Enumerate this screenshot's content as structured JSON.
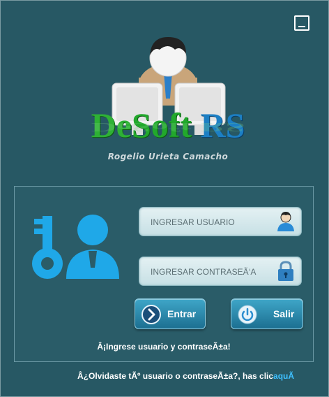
{
  "window": {
    "minimize_icon": "minimize-icon"
  },
  "brand": {
    "part1": "De",
    "part2": "Soft",
    "part3": " RS",
    "reflection": "DeSoft RS",
    "author": "Rogelio Urieta Camacho",
    "colors": {
      "green": "#22a82c",
      "blue": "#1c7fc4"
    }
  },
  "login": {
    "user_placeholder": "INGRESAR USUARIO",
    "password_placeholder": "INGRESAR CONTRASEÃ‘A",
    "enter_label": "Entrar",
    "exit_label": "Salir",
    "message": "Â¡Ingrese usuario y contraseÃ±a!"
  },
  "footer": {
    "forgot_text": "Â¿Olvidaste tÃº usuario o contraseÃ±a?, has clic",
    "forgot_link": "aquÃ­"
  }
}
